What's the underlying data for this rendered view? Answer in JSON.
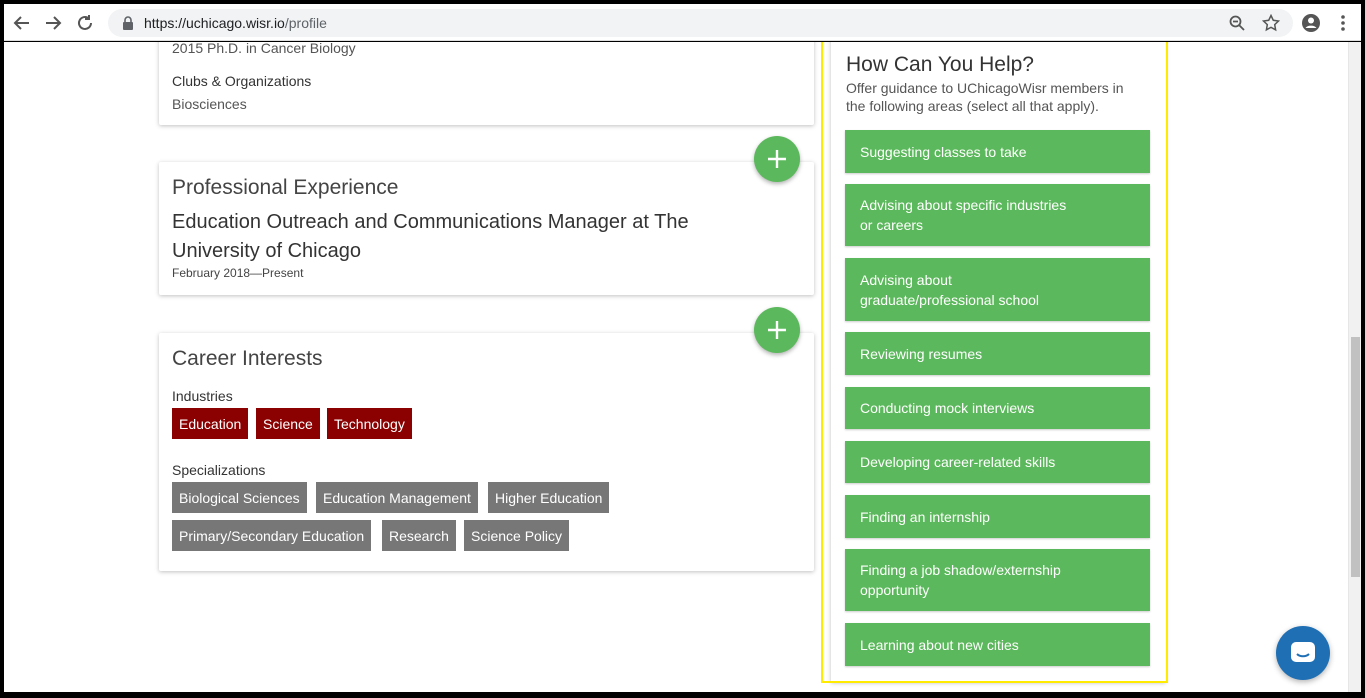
{
  "browser": {
    "url_host": "https://uchicago.wisr.io",
    "url_path": "/profile"
  },
  "education_card": {
    "degree": "2015 Ph.D. in Cancer Biology",
    "clubs_label": "Clubs & Organizations",
    "clubs_value": "Biosciences"
  },
  "experience_card": {
    "title": "Professional Experience",
    "job_line1": "Education Outreach and Communications Manager at The",
    "job_line2": "University of Chicago",
    "dates": "February 2018—Present"
  },
  "career_card": {
    "title": "Career Interests",
    "industries_label": "Industries",
    "industries": [
      "Education",
      "Science",
      "Technology"
    ],
    "specializations_label": "Specializations",
    "specializations": [
      "Biological Sciences",
      "Education Management",
      "Higher Education",
      "Primary/Secondary Education",
      "Research",
      "Science Policy"
    ]
  },
  "help_panel": {
    "title": "How Can You Help?",
    "subtitle_line1": "Offer guidance to UChicagoWisr members in",
    "subtitle_line2": "the following areas (select all that apply).",
    "options": [
      {
        "line1": "Suggesting classes to take",
        "line2": ""
      },
      {
        "line1": "Advising about specific industries",
        "line2": "or careers"
      },
      {
        "line1": "Advising about",
        "line2": "graduate/professional school"
      },
      {
        "line1": "Reviewing resumes",
        "line2": ""
      },
      {
        "line1": "Conducting mock interviews",
        "line2": ""
      },
      {
        "line1": "Developing career-related skills",
        "line2": ""
      },
      {
        "line1": "Finding an internship",
        "line2": ""
      },
      {
        "line1": "Finding a job shadow/externship",
        "line2": "opportunity"
      },
      {
        "line1": "Learning about new cities",
        "line2": ""
      }
    ]
  },
  "colors": {
    "accent_green": "#5cb85c",
    "industry_tag": "#8b0000",
    "specialization_tag": "#777777",
    "highlight": "#ffeb00",
    "chat": "#1f6fb5"
  },
  "icons": {
    "back": "back-arrow-icon",
    "forward": "forward-arrow-icon",
    "reload": "reload-icon",
    "lock": "lock-icon",
    "zoom": "zoom-icon",
    "star": "star-icon",
    "account": "account-icon",
    "menu": "kebab-menu-icon",
    "add": "plus-icon",
    "chat": "chat-icon"
  }
}
